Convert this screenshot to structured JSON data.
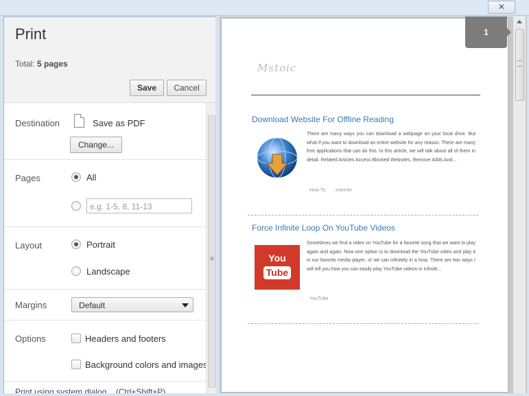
{
  "window": {
    "close_label": "✕",
    "minimize_label": "▁"
  },
  "panel": {
    "title": "Print",
    "total_label": "Total:",
    "total_value": "5 pages",
    "save_label": "Save",
    "cancel_label": "Cancel"
  },
  "destination": {
    "label": "Destination",
    "value": "Save as PDF",
    "change_label": "Change..."
  },
  "pages": {
    "label": "Pages",
    "all_label": "All",
    "selected": "All",
    "range_placeholder": "e.g. 1-5, 8, 11-13"
  },
  "layout": {
    "label": "Layout",
    "portrait_label": "Portrait",
    "landscape_label": "Landscape",
    "selected": "Portrait"
  },
  "margins": {
    "label": "Margins",
    "value": "Default"
  },
  "options": {
    "label": "Options",
    "headers_label": "Headers and footers",
    "background_label": "Background colors and images",
    "headers_checked": false,
    "background_checked": false
  },
  "shortcut": {
    "text": "Print using system dialog... (Ctrl+Shift+P)"
  },
  "preview": {
    "page_number": "1",
    "site_logo": "Mstoic",
    "articles": [
      {
        "title": "Download Website For Offline Reading",
        "excerpt": "There are many ways you can download a webpage on your local drive. But what if you want to download an entire website for any reason. There are many free applications that can do this. In this article, we will talk about all of them in detail. Related Articles Access Blocked Websites, Remove Adds And...",
        "tags": [
          "How To",
          "Internet"
        ],
        "image_icon": "download-globe-icon"
      },
      {
        "title": "Force Infinite Loop On YouTube Videos",
        "excerpt": "Sometimes we find a video on YouTube for a favorite song that we want to play again and again. Now one option is to download the YouTube video and play it in our favorite media player, or we can infinitely in a loop. There are two ways I will tell you how you can easily play YouTube videos in infinite...",
        "tags": [
          "YouTube"
        ],
        "image_icon": "youtube-logo-icon",
        "logo_text_top": "You",
        "logo_text_bottom": "Tube"
      }
    ]
  },
  "colors": {
    "link_blue": "#3a79b0",
    "youtube_red": "#d13a2a",
    "window_frame": "#d6e3f1"
  }
}
